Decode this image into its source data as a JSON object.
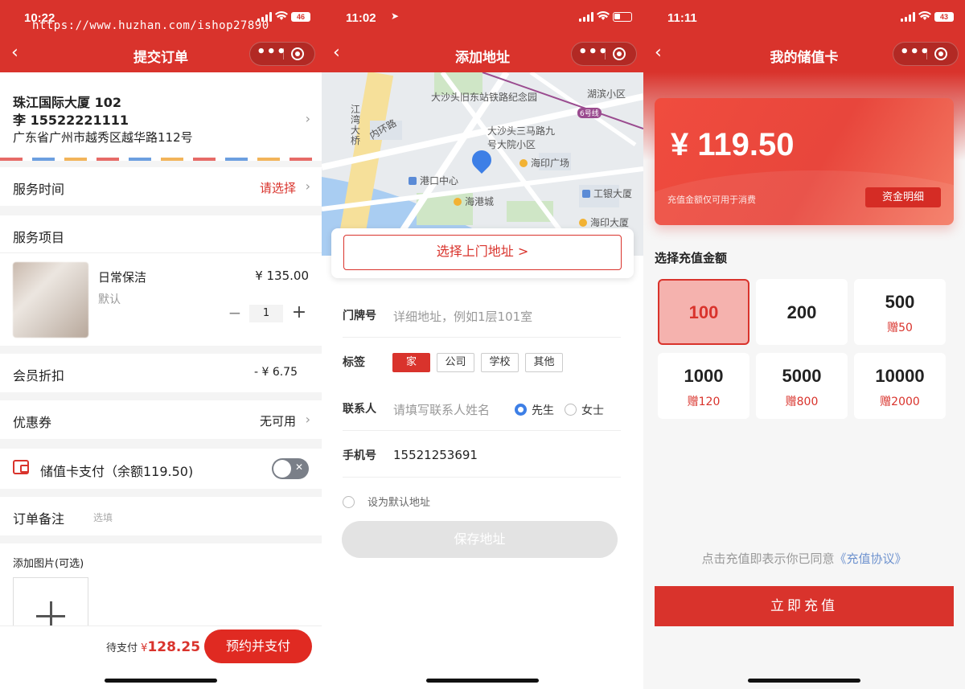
{
  "watermark": "https://www.huzhan.com/ishop27890",
  "colors": {
    "brand_red": "#d9332c",
    "selected_fill": "#f5b2ae",
    "link_blue": "#6f93cf"
  },
  "order_screen": {
    "status": {
      "time": "10:22",
      "battery": "46"
    },
    "nav": {
      "title": "提交订单",
      "back_icon": "chevron-left-icon",
      "more_icon": "more-dots-icon",
      "close_icon": "target-icon"
    },
    "address": {
      "building": "珠江国际大厦 102",
      "contact": "李 15522221111",
      "detail": "广东省广州市越秀区越华路112号"
    },
    "service_time": {
      "label": "服务时间",
      "value": "请选择"
    },
    "service_items": {
      "label": "服务项目",
      "item": {
        "name": "日常保洁",
        "spec": "默认",
        "price": "¥ 135.00",
        "qty": "1",
        "minus": "−",
        "plus": "+"
      }
    },
    "member_discount": {
      "label": "会员折扣",
      "value": "- ¥ 6.75"
    },
    "coupon": {
      "label": "优惠券",
      "value": "无可用"
    },
    "card_pay": {
      "label": "储值卡支付（余额119.50)",
      "toggle_on": false
    },
    "order_note": {
      "label": "订单备注",
      "placeholder": "选填"
    },
    "photos": {
      "label": "添加图片(可选)"
    },
    "footer": {
      "due_label": "待支付",
      "currency": "¥",
      "due_amount": "128.25",
      "pay_button": "预约并支付"
    }
  },
  "address_screen": {
    "status": {
      "time": "11:02"
    },
    "nav": {
      "title": "添加地址"
    },
    "map": {
      "pois": [
        {
          "label": "大沙头旧东站铁路纪念园",
          "kind": "bus"
        },
        {
          "label": "湖滨小区",
          "kind": "area"
        },
        {
          "label": "大沙头三马路九号大院小区",
          "kind": "area"
        },
        {
          "label": "海印广场",
          "kind": "shop"
        },
        {
          "label": "港口中心",
          "kind": "bus"
        },
        {
          "label": "海港城",
          "kind": "shop"
        },
        {
          "label": "工银大厦",
          "kind": "bus"
        },
        {
          "label": "海印大厦",
          "kind": "shop"
        },
        {
          "label": "江湾大桥",
          "kind": "road"
        },
        {
          "label": "内环路",
          "kind": "road"
        },
        {
          "label": "6号线",
          "kind": "metro"
        }
      ]
    },
    "pick_button": "选择上门地址 >",
    "form": {
      "door": {
        "label": "门牌号",
        "placeholder": "详细地址，例如1层101室"
      },
      "tag": {
        "label": "标签",
        "options": [
          "家",
          "公司",
          "学校",
          "其他"
        ],
        "selected": "家"
      },
      "contact": {
        "label": "联系人",
        "placeholder": "请填写联系人姓名",
        "genders": [
          "先生",
          "女士"
        ],
        "selected_gender": "先生"
      },
      "phone": {
        "label": "手机号",
        "value": "15521253691"
      },
      "default_label": "设为默认地址"
    },
    "save_button": "保存地址"
  },
  "card_screen": {
    "status": {
      "time": "11:11",
      "battery": "43"
    },
    "nav": {
      "title": "我的储值卡"
    },
    "balance": "¥ 119.50",
    "balance_hint": "充值金额仅可用于消费",
    "detail_button": "资金明细",
    "section_title": "选择充值金额",
    "options": [
      {
        "amount": "100",
        "bonus": "",
        "selected": true
      },
      {
        "amount": "200",
        "bonus": "",
        "selected": false
      },
      {
        "amount": "500",
        "bonus": "赠50",
        "selected": false
      },
      {
        "amount": "1000",
        "bonus": "赠120",
        "selected": false
      },
      {
        "amount": "5000",
        "bonus": "赠800",
        "selected": false
      },
      {
        "amount": "10000",
        "bonus": "赠2000",
        "selected": false
      }
    ],
    "agreement_text": "点击充值即表示你已同意",
    "agreement_link": "《充值协议》",
    "charge_button": "立即充值"
  }
}
